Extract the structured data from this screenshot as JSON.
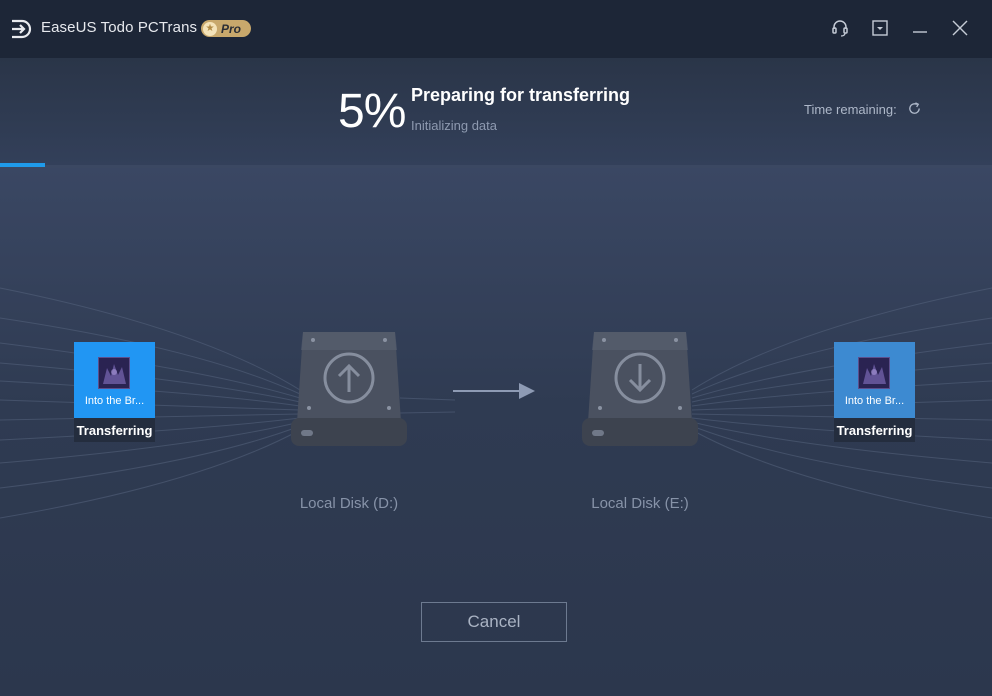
{
  "titlebar": {
    "app_name": "EaseUS Todo PCTrans",
    "badge": "Pro",
    "icons": [
      "headset-icon",
      "minimize-to-tray-icon",
      "minimize-icon",
      "close-icon"
    ]
  },
  "progress": {
    "percent_text": "5%",
    "percent_value": 5,
    "title": "Preparing for transferring",
    "subtitle": "Initializing data",
    "time_remaining_label": "Time remaining:"
  },
  "transfer": {
    "source_file": {
      "name": "Into the Br...",
      "status": "Transferring"
    },
    "target_file": {
      "name": "Into the Br...",
      "status": "Transferring"
    },
    "source_disk": "Local Disk (D:)",
    "target_disk": "Local Disk (E:)"
  },
  "actions": {
    "cancel_label": "Cancel"
  },
  "colors": {
    "accent": "#1f9bea",
    "titlebar": "#1d2637",
    "background": "#2f3b50",
    "pro_badge": "#c8a86c"
  }
}
